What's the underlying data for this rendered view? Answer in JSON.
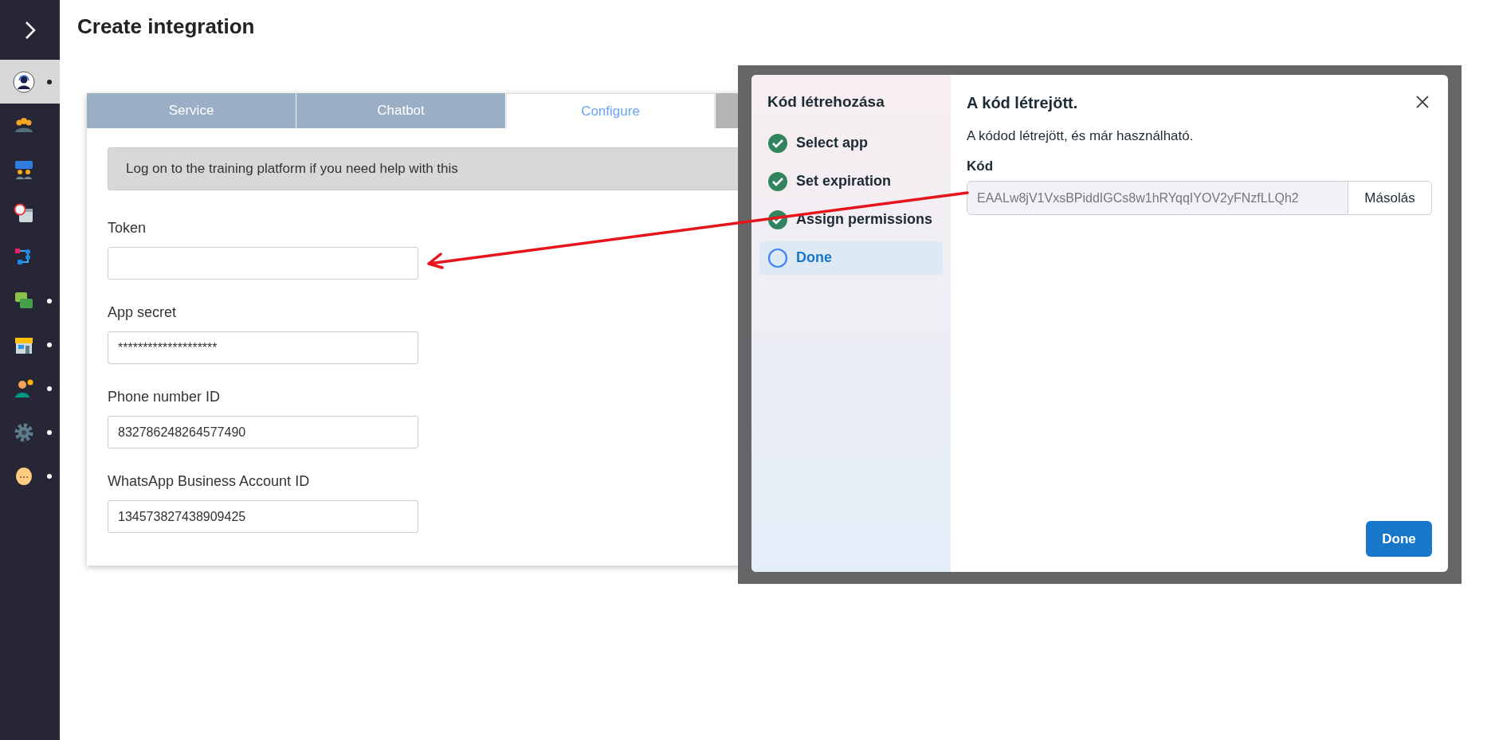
{
  "sidebar": {
    "items": [
      {
        "kind": "agent",
        "selected": true,
        "dot": true
      },
      {
        "kind": "team",
        "selected": false,
        "dot": false
      },
      {
        "kind": "chat-people",
        "selected": false,
        "dot": false
      },
      {
        "kind": "calendar",
        "selected": false,
        "dot": false
      },
      {
        "kind": "flow",
        "selected": false,
        "dot": false
      },
      {
        "kind": "qa",
        "selected": false,
        "dot": true
      },
      {
        "kind": "store",
        "selected": false,
        "dot": true
      },
      {
        "kind": "user-gear",
        "selected": false,
        "dot": true
      },
      {
        "kind": "gear",
        "selected": false,
        "dot": true
      },
      {
        "kind": "face",
        "selected": false,
        "dot": true
      }
    ]
  },
  "page": {
    "title": "Create integration"
  },
  "tabs": [
    {
      "label": "Service",
      "selected": false
    },
    {
      "label": "Chatbot",
      "selected": false
    },
    {
      "label": "Configure",
      "selected": true
    }
  ],
  "info": "Log on to the training platform if you need help with this",
  "fields": [
    {
      "label": "Token"
    },
    {
      "label": "App secret",
      "value": "********************"
    },
    {
      "label": "Phone number ID",
      "value": "832786248264577490"
    },
    {
      "label": "WhatsApp Business Account ID",
      "value": "134573827438909425"
    }
  ],
  "screenshot": {
    "dialog": {
      "sidebar_title": "Kód létrehozása",
      "steps": [
        {
          "label": "Select app",
          "done": true,
          "selected": false
        },
        {
          "label": "Set expiration",
          "done": true,
          "selected": false
        },
        {
          "label": "Assign permissions",
          "done": true,
          "selected": false
        },
        {
          "label": "Done",
          "done": false,
          "selected": true
        }
      ],
      "title": "A kód létrejött.",
      "description": "A kódod létrejött, és már használható.",
      "code_label": "Kód",
      "code_value": "EAALw8jV1VxsBPiddIGCs8w1hRYqqIYOV2yFNzfLLQh2",
      "copy_button": "Másolás",
      "done_button": "Done"
    }
  }
}
